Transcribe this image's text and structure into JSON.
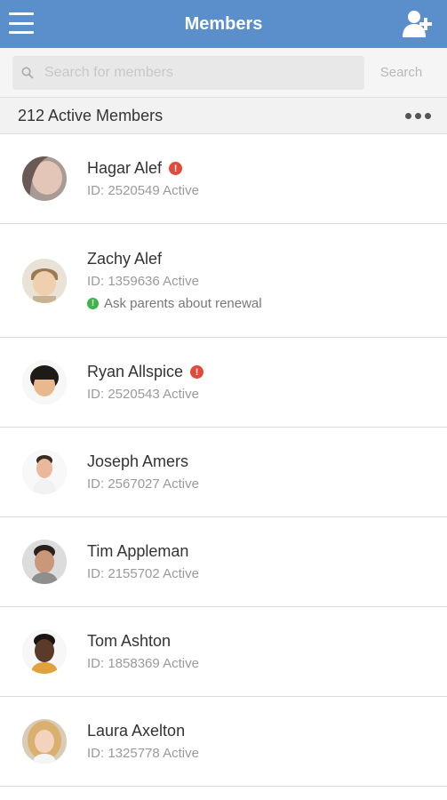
{
  "header": {
    "title": "Members",
    "menu_icon": "hamburger-menu-icon",
    "add_icon": "add-member-icon",
    "color": "#5a8fcc"
  },
  "search": {
    "placeholder": "Search for members",
    "value": "",
    "button_label": "Search"
  },
  "summary": {
    "count_label": "212 Active Members",
    "more_icon": "more-options-icon"
  },
  "members": [
    {
      "name": "Hagar Alef",
      "id_line": "ID: 2520549 Active",
      "alert": true,
      "alert_text": "!",
      "note": ""
    },
    {
      "name": "Zachy Alef",
      "id_line": "ID: 1359636 Active",
      "alert": false,
      "alert_text": "",
      "note": "Ask parents about renewal",
      "note_icon": "!"
    },
    {
      "name": "Ryan Allspice",
      "id_line": "ID: 2520543 Active",
      "alert": true,
      "alert_text": "!",
      "note": ""
    },
    {
      "name": "Joseph Amers",
      "id_line": "ID: 2567027 Active",
      "alert": false,
      "alert_text": "",
      "note": ""
    },
    {
      "name": "Tim Appleman",
      "id_line": "ID: 2155702 Active",
      "alert": false,
      "alert_text": "",
      "note": ""
    },
    {
      "name": "Tom Ashton",
      "id_line": "ID: 1858369 Active",
      "alert": false,
      "alert_text": "",
      "note": ""
    },
    {
      "name": "Laura Axelton",
      "id_line": "ID: 1325778 Active",
      "alert": false,
      "alert_text": "",
      "note": ""
    }
  ],
  "colors": {
    "alert": "#e04b3c",
    "note": "#3cb54a"
  }
}
